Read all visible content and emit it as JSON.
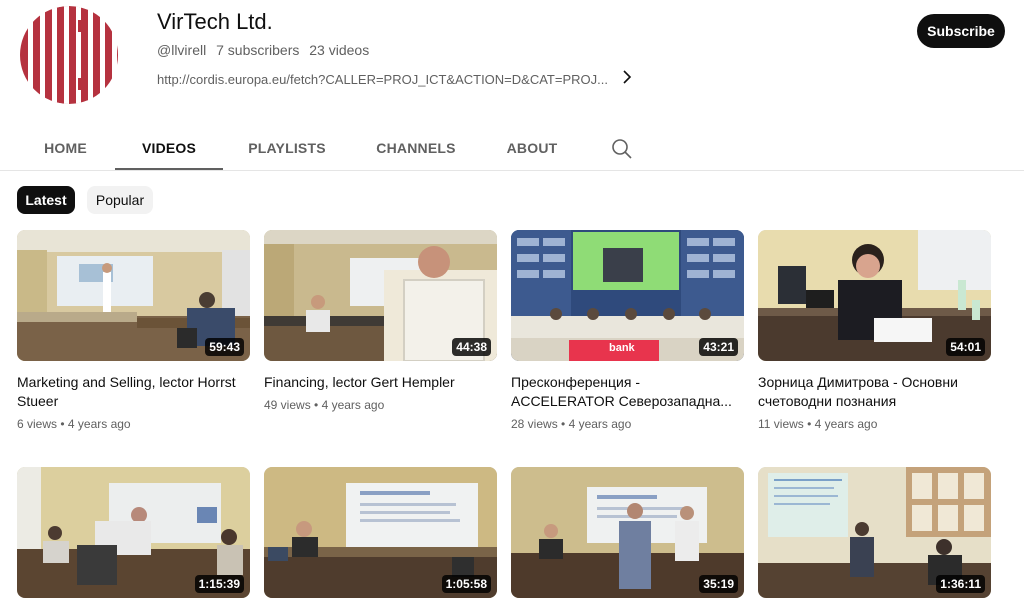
{
  "channel": {
    "name": "VirTech Ltd.",
    "handle": "@llvirell",
    "subscribers": "7 subscribers",
    "videos_count": "23 videos",
    "link": "http://cordis.europa.eu/fetch?CALLER=PROJ_ICT&ACTION=D&CAT=PROJ...",
    "subscribe_label": "Subscribe",
    "logo_color": "#b5323f"
  },
  "tabs": [
    {
      "label": "HOME"
    },
    {
      "label": "VIDEOS"
    },
    {
      "label": "PLAYLISTS"
    },
    {
      "label": "CHANNELS"
    },
    {
      "label": "ABOUT"
    }
  ],
  "active_tab": "VIDEOS",
  "chips": {
    "latest": "Latest",
    "popular": "Popular"
  },
  "videos": [
    {
      "title": "Marketing and Selling, lector Horrst Stueer",
      "views": "6 views",
      "age": "4 years ago",
      "duration": "59:43"
    },
    {
      "title": "Financing, lector Gert Hempler",
      "views": "49 views",
      "age": "4 years ago",
      "duration": "44:38"
    },
    {
      "title": "Пресконференция - ACCELERATOR Северозападна...",
      "views": "28 views",
      "age": "4 years ago",
      "duration": "43:21"
    },
    {
      "title": "Зорница Димитрова - Основни счетоводни познания",
      "views": "11 views",
      "age": "4 years ago",
      "duration": "54:01"
    },
    {
      "title": "",
      "views": "",
      "age": "",
      "duration": "1:15:39"
    },
    {
      "title": "",
      "views": "",
      "age": "",
      "duration": "1:05:58"
    },
    {
      "title": "",
      "views": "",
      "age": "",
      "duration": "35:19"
    },
    {
      "title": "",
      "views": "",
      "age": "",
      "duration": "1:36:11"
    }
  ],
  "thumb_texts": {
    "bank_banner": "bank"
  }
}
